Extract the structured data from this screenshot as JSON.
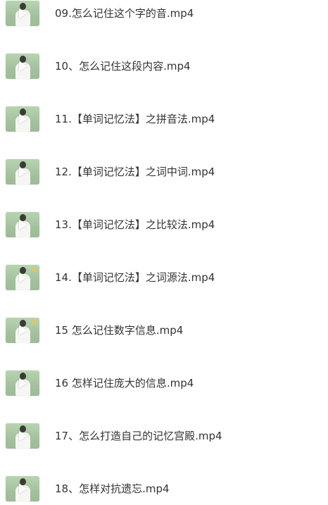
{
  "files": [
    {
      "name": "09.怎么记住这个字的音.mp4",
      "icon": "video-thumbnail-icon"
    },
    {
      "name": "10、怎么记住这段内容.mp4",
      "icon": "video-thumbnail-icon"
    },
    {
      "name": "11.【单词记忆法】之拼音法.mp4",
      "icon": "video-thumbnail-icon"
    },
    {
      "name": "12.【单词记忆法】之词中词.mp4",
      "icon": "video-thumbnail-icon"
    },
    {
      "name": "13.【单词记忆法】之比较法.mp4",
      "icon": "video-thumbnail-icon"
    },
    {
      "name": "14.【单词记忆法】之词源法.mp4",
      "icon": "video-thumbnail-icon"
    },
    {
      "name": "15 怎么记住数字信息.mp4",
      "icon": "video-thumbnail-icon"
    },
    {
      "name": "16 怎样记住庞大的信息.mp4",
      "icon": "video-thumbnail-icon"
    },
    {
      "name": "17、怎么打造自己的记忆宫殿.mp4",
      "icon": "video-thumbnail-icon"
    },
    {
      "name": "18、怎样对抗遗忘.mp4",
      "icon": "video-thumbnail-icon"
    }
  ],
  "colors": {
    "text": "#333333",
    "thumbnail_bg": "#a9c7a3",
    "background": "#ffffff"
  }
}
